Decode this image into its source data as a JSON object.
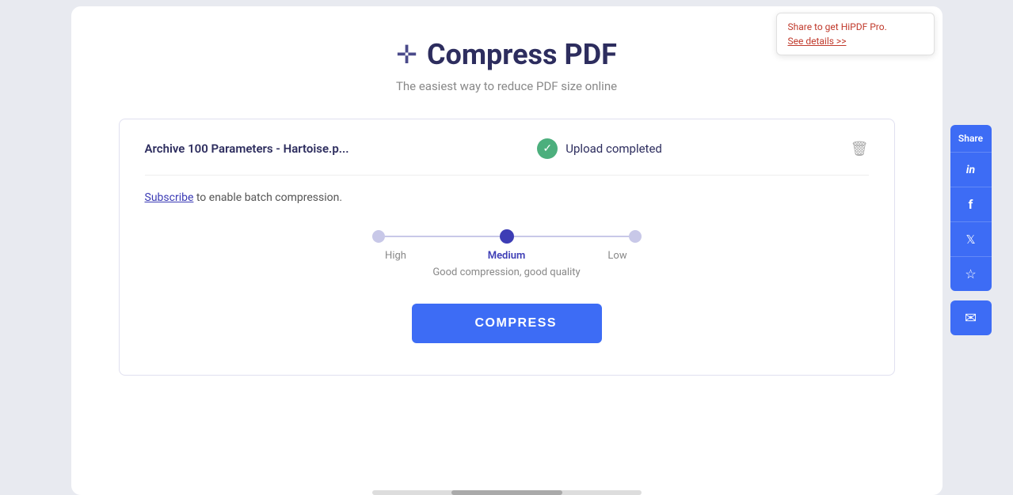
{
  "page": {
    "title": "Compress PDF",
    "subtitle": "The easiest way to reduce PDF size online",
    "icon": "⊹"
  },
  "file": {
    "name": "Archive 100 Parameters - Hartoise.p...",
    "upload_status": "Upload completed"
  },
  "subscribe": {
    "link_text": "Subscribe",
    "rest_text": " to enable batch compression."
  },
  "compression": {
    "options": [
      {
        "label": "High",
        "active": false
      },
      {
        "label": "Medium",
        "active": true
      },
      {
        "label": "Low",
        "active": false
      }
    ],
    "description": "Good compression, good quality"
  },
  "buttons": {
    "compress": "COMPRESS"
  },
  "share": {
    "label": "Share",
    "linkedin": "in",
    "facebook": "f",
    "twitter": "🐦",
    "star": "☆",
    "email": "✉"
  },
  "promo": {
    "line1": "Share to get HiPDF Pro.",
    "line2": "See details >>"
  }
}
